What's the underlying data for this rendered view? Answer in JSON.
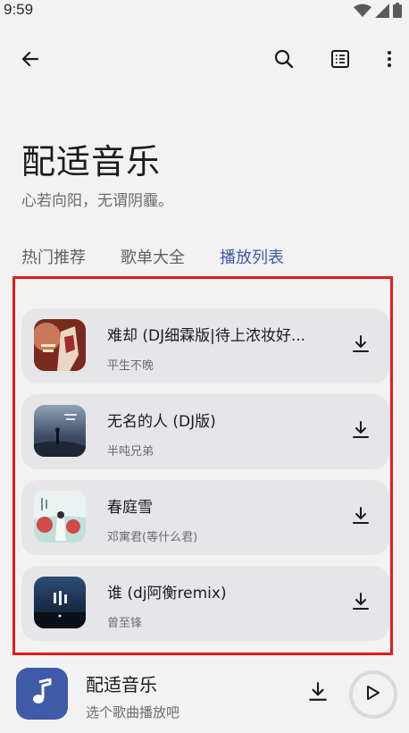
{
  "status_bar": {
    "time": "9:59",
    "icons": [
      "wifi-icon",
      "signal-icon",
      "battery-icon"
    ]
  },
  "toolbar": {
    "back_icon": "arrow-left-icon",
    "search_icon": "search-icon",
    "list_icon": "list-icon",
    "more_icon": "more-vertical-icon"
  },
  "header": {
    "title": "配适音乐",
    "subtitle": "心若向阳，无谓阴霾。"
  },
  "tabs": [
    {
      "label": "热门推荐",
      "selected": false
    },
    {
      "label": "歌单大全",
      "selected": false
    },
    {
      "label": "播放列表",
      "selected": true
    }
  ],
  "playlist": {
    "songs": [
      {
        "title": "难却 (DJ细霖版|待上浓妆好...",
        "artist": "平生不晚",
        "action_icon": "download-icon"
      },
      {
        "title": "无名的人 (DJ版)",
        "artist": "半吨兄弟",
        "action_icon": "download-icon"
      },
      {
        "title": "春庭雪",
        "artist": "邓寓君(等什么君)",
        "action_icon": "download-icon"
      },
      {
        "title": "谁 (dj阿衡remix)",
        "artist": "曾至锋",
        "action_icon": "download-icon"
      }
    ]
  },
  "player": {
    "title": "配适音乐",
    "subtitle": "选个歌曲播放吧",
    "art_icon": "music-note-icon",
    "download_icon": "download-icon",
    "play_icon": "play-icon"
  },
  "colors": {
    "accent": "#3f5aa8",
    "background": "#f2f2f3",
    "card": "#e6e6e9",
    "highlight_frame": "#e21c1c"
  }
}
